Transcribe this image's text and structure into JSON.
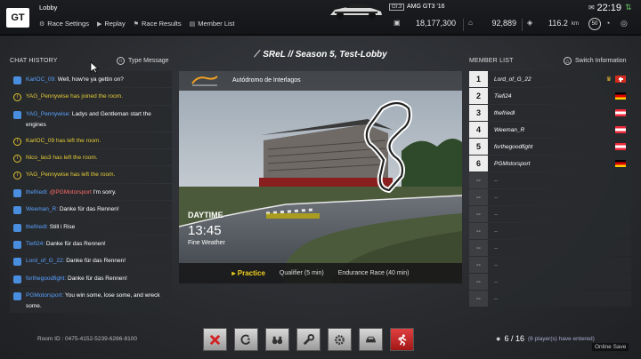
{
  "header": {
    "logo_text": "GT",
    "title": "Lobby",
    "nav": [
      {
        "label": "Race Settings"
      },
      {
        "label": "Replay"
      },
      {
        "label": "Race Results"
      },
      {
        "label": "Member List"
      }
    ],
    "car_class": "Gr.3",
    "car_name": "AMG GT3 '16",
    "credits": "18,177,300",
    "mileage": "92,889",
    "distance_value": "116.2",
    "distance_unit": "km",
    "level": "50",
    "time": "22:19"
  },
  "chat": {
    "label": "CHAT HISTORY",
    "type_message": "Type Message",
    "messages": [
      {
        "kind": "chat",
        "name": "KarlOC_09:",
        "text": "Well, how're ya gettin on?"
      },
      {
        "kind": "info",
        "text": "YAG_Pennywise has joined the room."
      },
      {
        "kind": "chat",
        "name": "YAG_Pennywise:",
        "text": "Ladys and Gentleman start the engines"
      },
      {
        "kind": "info",
        "text": "KarlOC_09 has left the room."
      },
      {
        "kind": "info",
        "text": "Nico_las3 has left the room."
      },
      {
        "kind": "info",
        "text": "YAG_Pennywise has left the room."
      },
      {
        "kind": "chat",
        "name": "thefriedl:",
        "mention": "@PGMotorsport",
        "text": "I'm sorry."
      },
      {
        "kind": "chat",
        "name": "Weeman_R:",
        "text": "Danke für das Rennen!"
      },
      {
        "kind": "chat",
        "name": "thefriedl:",
        "text": "Still i Rise"
      },
      {
        "kind": "chat",
        "name": "Tiefi24:",
        "text": "Danke für das Rennen!"
      },
      {
        "kind": "chat",
        "name": "Lord_of_G_22:",
        "text": "Danke für das Rennen!"
      },
      {
        "kind": "chat",
        "name": "forthegoodfight:",
        "text": "Danke für das Rennen!"
      },
      {
        "kind": "chat",
        "name": "PGMotorsport:",
        "text": "You win some, lose some, and wreck some."
      }
    ]
  },
  "lobby": {
    "name": "SReL // Season 5, Test-Lobby",
    "track_name": "Autódromo de Interlagos",
    "daytime_label": "DAYTIME",
    "clock": "13:45",
    "weather": "Fine Weather",
    "sessions": [
      {
        "label": "Practice",
        "active": true
      },
      {
        "label": "Qualifier (5 min)",
        "active": false
      },
      {
        "label": "Endurance Race (40 min)",
        "active": false
      }
    ]
  },
  "members": {
    "label": "MEMBER LIST",
    "switch_info": "Switch Information",
    "rows": [
      {
        "num": "1",
        "name": "Lord_of_G_22",
        "flag": "ch",
        "host": true
      },
      {
        "num": "2",
        "name": "Tiefi24",
        "flag": "de"
      },
      {
        "num": "3",
        "name": "thefriedl",
        "flag": "at"
      },
      {
        "num": "4",
        "name": "Weeman_R",
        "flag": "at"
      },
      {
        "num": "5",
        "name": "forthegoodfight",
        "flag": "at"
      },
      {
        "num": "6",
        "name": "PGMotorsport",
        "flag": "de"
      },
      {
        "num": "--",
        "name": "--"
      },
      {
        "num": "--",
        "name": "--"
      },
      {
        "num": "--",
        "name": "--"
      },
      {
        "num": "--",
        "name": "--"
      },
      {
        "num": "--",
        "name": "--"
      },
      {
        "num": "--",
        "name": "--"
      },
      {
        "num": "--",
        "name": "--"
      },
      {
        "num": "--",
        "name": "--"
      }
    ]
  },
  "footer": {
    "room_id": "Room ID : 0475-4152-5239-6266-8100",
    "player_count": "6 / 16",
    "player_sub": "(6 player(s) have entered)",
    "online_save": "Online Save"
  },
  "colors": {
    "accent_yellow": "#f0d020",
    "chat_name_blue": "#5aa2ff",
    "system_yellow": "#e5cc37",
    "mention_red": "#ff6a6a"
  }
}
